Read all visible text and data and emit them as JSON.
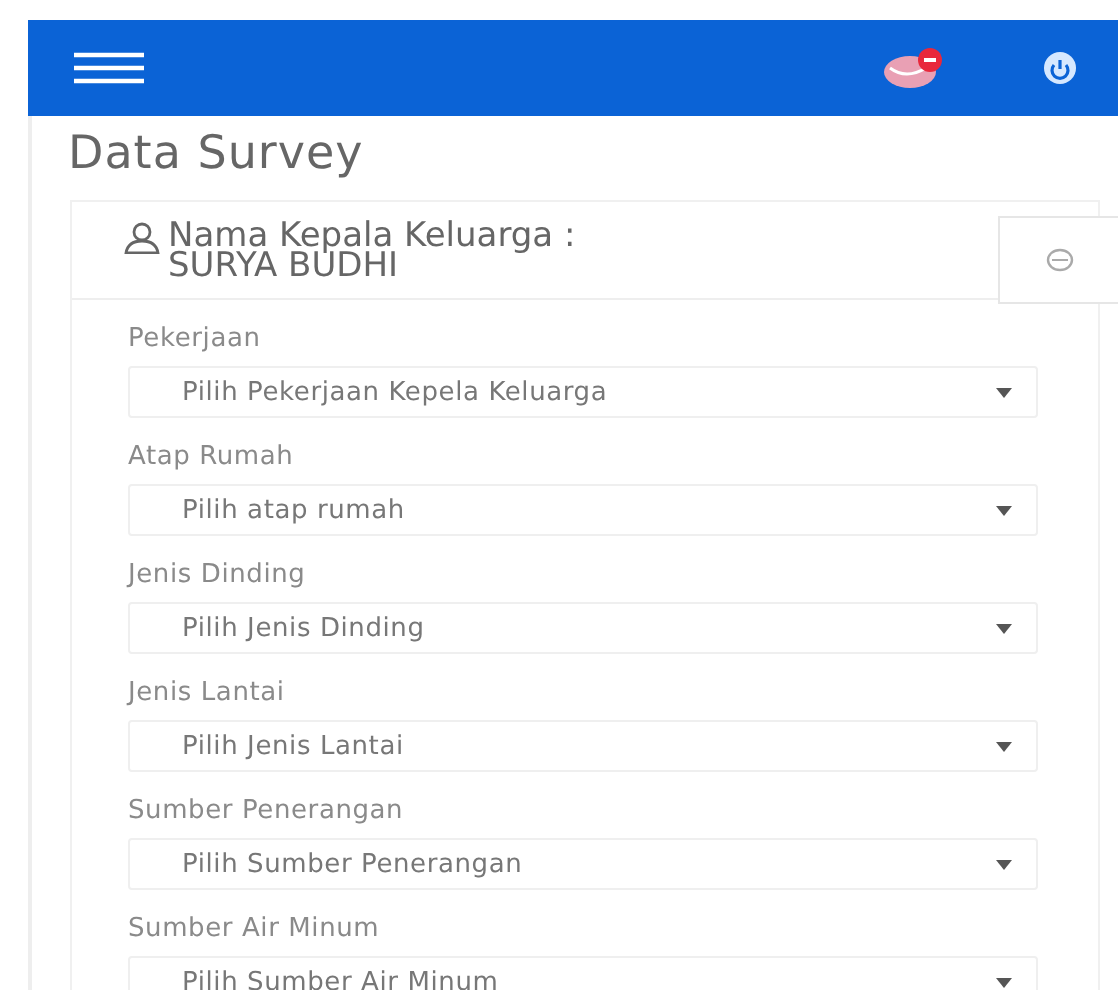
{
  "page_title": "Data Survey",
  "head_of_family": {
    "label": "Nama Kepala Keluarga :",
    "name": "SURYA BUDHI"
  },
  "fields": [
    {
      "label": "Pekerjaan",
      "placeholder": "Pilih Pekerjaan Kepela Keluarga"
    },
    {
      "label": "Atap Rumah",
      "placeholder": "Pilih atap rumah"
    },
    {
      "label": "Jenis Dinding",
      "placeholder": "Pilih Jenis Dinding"
    },
    {
      "label": "Jenis Lantai",
      "placeholder": "Pilih Jenis Lantai"
    },
    {
      "label": "Sumber Penerangan",
      "placeholder": "Pilih Sumber Penerangan"
    },
    {
      "label": "Sumber Air Minum",
      "placeholder": "Pilih Sumber Air Minum"
    }
  ]
}
